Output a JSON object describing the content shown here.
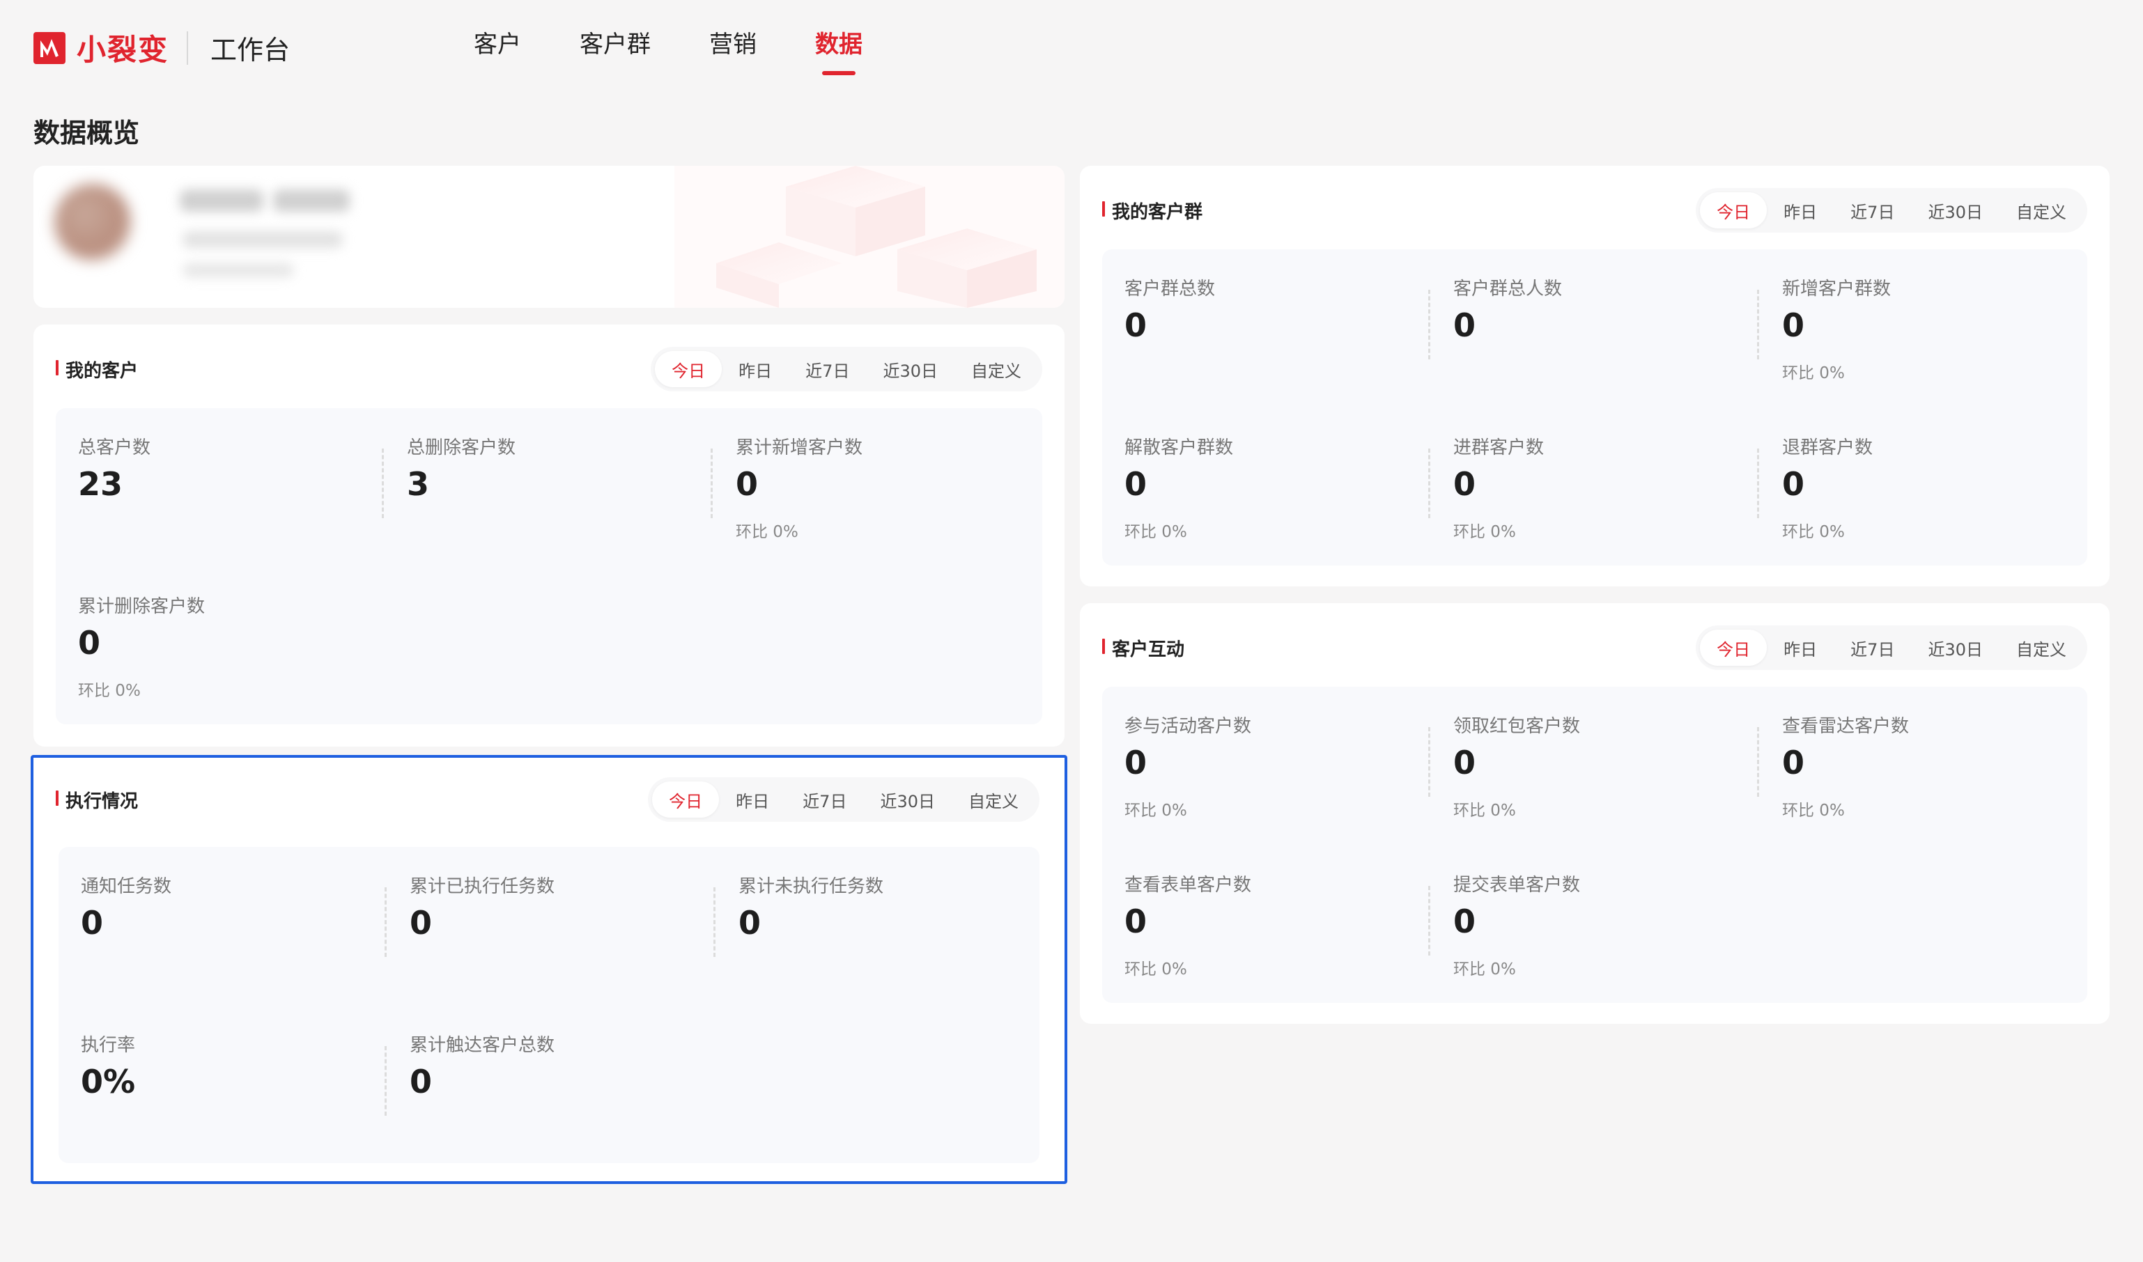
{
  "app": {
    "brand": "小裂变",
    "workbench": "工作台",
    "colors": {
      "accent": "#e0242e",
      "selection": "#1e5fe0"
    }
  },
  "nav": {
    "items": [
      {
        "label": "客户",
        "active": false
      },
      {
        "label": "客户群",
        "active": false
      },
      {
        "label": "营销",
        "active": false
      },
      {
        "label": "数据",
        "active": true
      }
    ]
  },
  "page": {
    "title": "数据概览"
  },
  "tabs": [
    "今日",
    "昨日",
    "近7日",
    "近30日",
    "自定义"
  ],
  "my_customers": {
    "title": "我的客户",
    "stats": [
      {
        "label": "总客户数",
        "value": "23",
        "ratio": ""
      },
      {
        "label": "总删除客户数",
        "value": "3",
        "ratio": ""
      },
      {
        "label": "累计新增客户数",
        "value": "0",
        "ratio": "环比 0%"
      },
      {
        "label": "累计删除客户数",
        "value": "0",
        "ratio": "环比 0%"
      }
    ]
  },
  "execution": {
    "title": "执行情况",
    "stats": [
      {
        "label": "通知任务数",
        "value": "0",
        "ratio": ""
      },
      {
        "label": "累计已执行任务数",
        "value": "0",
        "ratio": ""
      },
      {
        "label": "累计未执行任务数",
        "value": "0",
        "ratio": ""
      },
      {
        "label": "执行率",
        "value": "0%",
        "ratio": ""
      },
      {
        "label": "累计触达客户总数",
        "value": "0",
        "ratio": ""
      }
    ]
  },
  "my_groups": {
    "title": "我的客户群",
    "stats": [
      {
        "label": "客户群总数",
        "value": "0",
        "ratio": ""
      },
      {
        "label": "客户群总人数",
        "value": "0",
        "ratio": ""
      },
      {
        "label": "新增客户群数",
        "value": "0",
        "ratio": "环比 0%"
      },
      {
        "label": "解散客户群数",
        "value": "0",
        "ratio": "环比 0%"
      },
      {
        "label": "进群客户数",
        "value": "0",
        "ratio": "环比 0%"
      },
      {
        "label": "退群客户数",
        "value": "0",
        "ratio": "环比 0%"
      }
    ]
  },
  "interaction": {
    "title": "客户互动",
    "stats": [
      {
        "label": "参与活动客户数",
        "value": "0",
        "ratio": "环比 0%"
      },
      {
        "label": "领取红包客户数",
        "value": "0",
        "ratio": "环比 0%"
      },
      {
        "label": "查看雷达客户数",
        "value": "0",
        "ratio": "环比 0%"
      },
      {
        "label": "查看表单客户数",
        "value": "0",
        "ratio": "环比 0%"
      },
      {
        "label": "提交表单客户数",
        "value": "0",
        "ratio": "环比 0%"
      }
    ]
  }
}
